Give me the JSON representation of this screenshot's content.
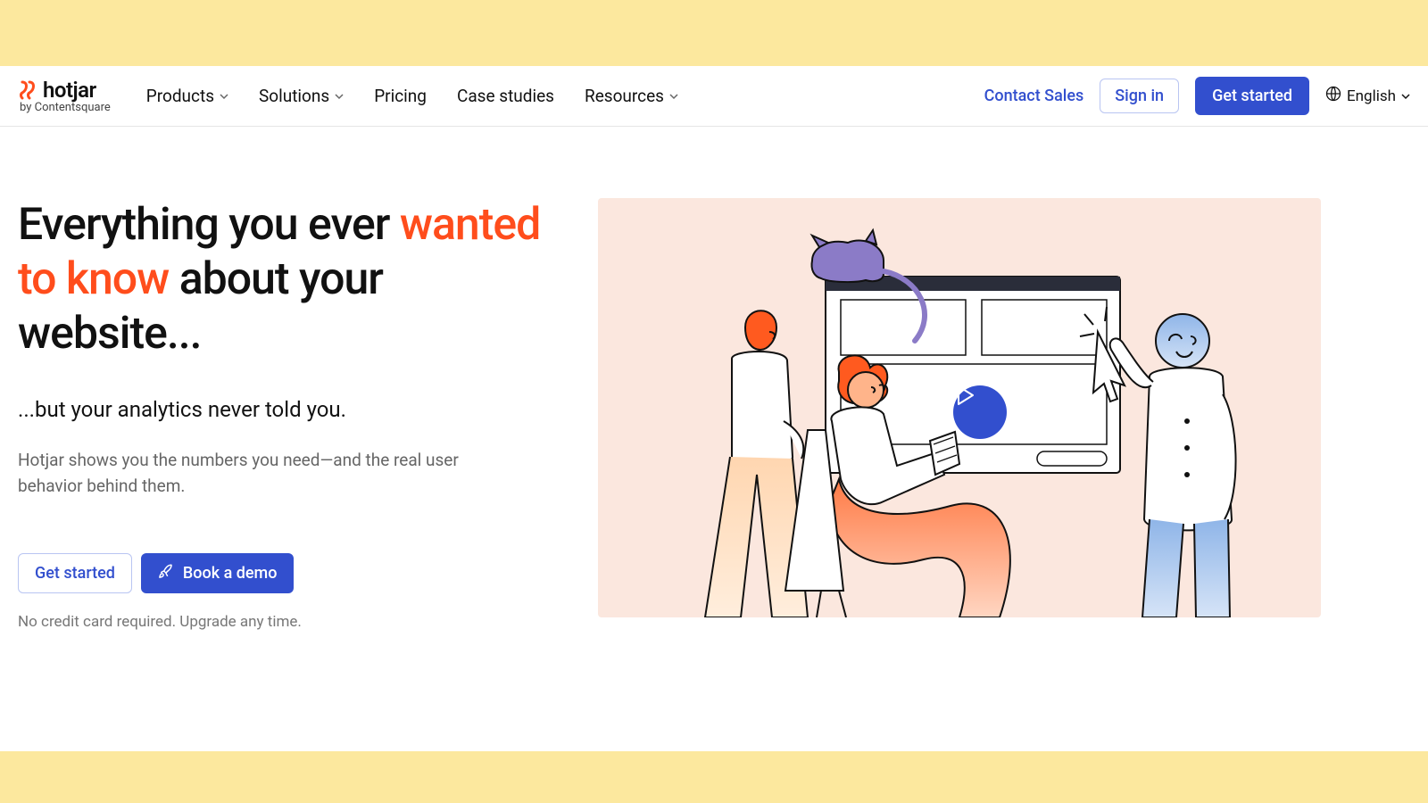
{
  "brand": {
    "name": "hotjar",
    "subtitle": "by Contentsquare"
  },
  "nav": {
    "items": [
      {
        "label": "Products",
        "dropdown": true
      },
      {
        "label": "Solutions",
        "dropdown": true
      },
      {
        "label": "Pricing",
        "dropdown": false
      },
      {
        "label": "Case studies",
        "dropdown": false
      },
      {
        "label": "Resources",
        "dropdown": true
      }
    ],
    "contact_sales": "Contact Sales",
    "sign_in": "Sign in",
    "get_started": "Get started",
    "language": "English"
  },
  "hero": {
    "h1_pre": "Everything you ever ",
    "h1_accent": "wanted to know",
    "h1_post": " about your website...",
    "sub1": "...but your analytics never told you.",
    "sub2": "Hotjar shows you the numbers you need—and the real user behavior behind them.",
    "cta_primary": "Get started",
    "cta_secondary": "Book a demo",
    "footnote": "No credit card required. Upgrade any time."
  },
  "colors": {
    "accent_red": "#ff4d1c",
    "brand_blue": "#324fce",
    "banner_yellow": "#fce89e",
    "illus_bg": "#fbe7de"
  }
}
